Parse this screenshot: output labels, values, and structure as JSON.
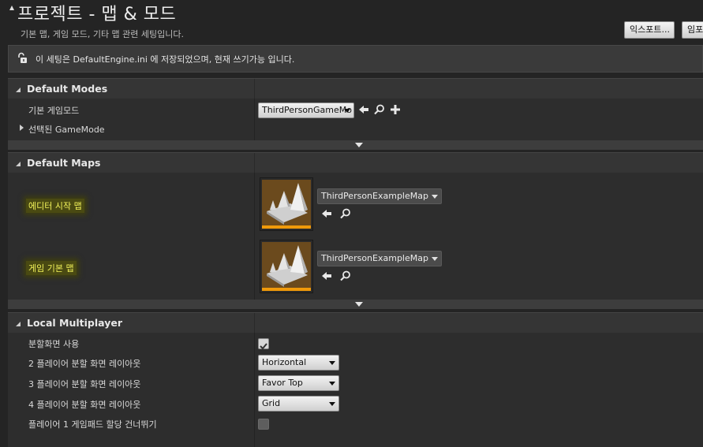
{
  "header": {
    "title": "프로젝트 - 맵 & 모드",
    "subtitle": "기본 맵, 게임 모드, 기타 맵 관련 세팅입니다.",
    "export_label": "익스포트...",
    "import_label": "임포트..."
  },
  "info_bar": {
    "text": "이 세팅은 DefaultEngine.ini 에 저장되었으며, 현재 쓰기가능 입니다."
  },
  "sections": {
    "default_modes": {
      "title": "Default Modes",
      "default_gamemode_label": "기본 게임모드",
      "default_gamemode_value": "ThirdPersonGameMo",
      "selected_gamemode_label": "선택된 GameMode"
    },
    "default_maps": {
      "title": "Default Maps",
      "editor_startup_label": "에디터 시작 맵",
      "editor_startup_value": "ThirdPersonExampleMap",
      "game_default_label": "게임 기본 맵",
      "game_default_value": "ThirdPersonExampleMap"
    },
    "local_multiplayer": {
      "title": "Local Multiplayer",
      "use_splitscreen_label": "분할화면 사용",
      "use_splitscreen_checked": true,
      "two_player_label": "2 플레이어 분할 화면 레이아웃",
      "two_player_value": "Horizontal",
      "three_player_label": "3 플레이어 분할 화면 레이아웃",
      "three_player_value": "Favor Top",
      "four_player_label": "4 플레이어 분할 화면 레이아웃",
      "four_player_value": "Grid",
      "skip_gamepad_label": "플레이어 1 게임패드 할당 건너뛰기",
      "skip_gamepad_checked": false
    }
  },
  "colors": {
    "highlight_text": "#f2f25a",
    "thumbnail_bar": "#f09a0a",
    "panel_bg": "#2d2d2d"
  }
}
